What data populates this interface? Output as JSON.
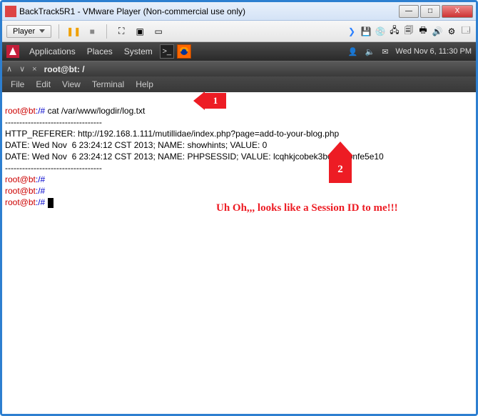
{
  "window": {
    "title": "BackTrack5R1 - VMware Player (Non-commercial use only)",
    "controls": {
      "min": "—",
      "max": "□",
      "close": "X"
    }
  },
  "vmware": {
    "playerLabel": "Player",
    "icons": {
      "play": "▶",
      "pause": "❚❚",
      "stop": "■",
      "fullscreen": "⛶",
      "unity": "▣",
      "present": "▭"
    },
    "tray": {
      "arrow": "❯",
      "disk1": "💾",
      "cd": "💿",
      "net": "🖧",
      "stack": "🗐",
      "printer": "🖶",
      "sound": "🔊",
      "usb": "⚙",
      "tools": "🗔"
    }
  },
  "gnome": {
    "apps": "Applications",
    "places": "Places",
    "system": "System",
    "dateTime": "Wed Nov  6, 11:30 PM",
    "icons": {
      "user": "👤",
      "sound": "🔈",
      "mail": "✉"
    }
  },
  "termwin": {
    "title": "root@bt: /",
    "menu": {
      "file": "File",
      "edit": "Edit",
      "view": "View",
      "terminal": "Terminal",
      "help": "Help"
    }
  },
  "terminal": {
    "promptUser": "root@bt",
    "promptSep": ":/# ",
    "cmd1": "cat /var/www/logdir/log.txt",
    "hr": "----------------------------------",
    "line1": "HTTP_REFERER: http://192.168.1.111/mutillidae/index.php?page=add-to-your-blog.php",
    "line2": "DATE: Wed Nov  6 23:24:12 CST 2013; NAME: showhints; VALUE: 0",
    "line3": "DATE: Wed Nov  6 23:24:12 CST 2013; NAME: PHPSESSID; VALUE: lcqhkjcobek3boku3lbnfe5e10"
  },
  "annot": {
    "n1": "1",
    "n2": "2",
    "caption": "Uh Oh,,, looks like a Session ID to me!!!"
  }
}
